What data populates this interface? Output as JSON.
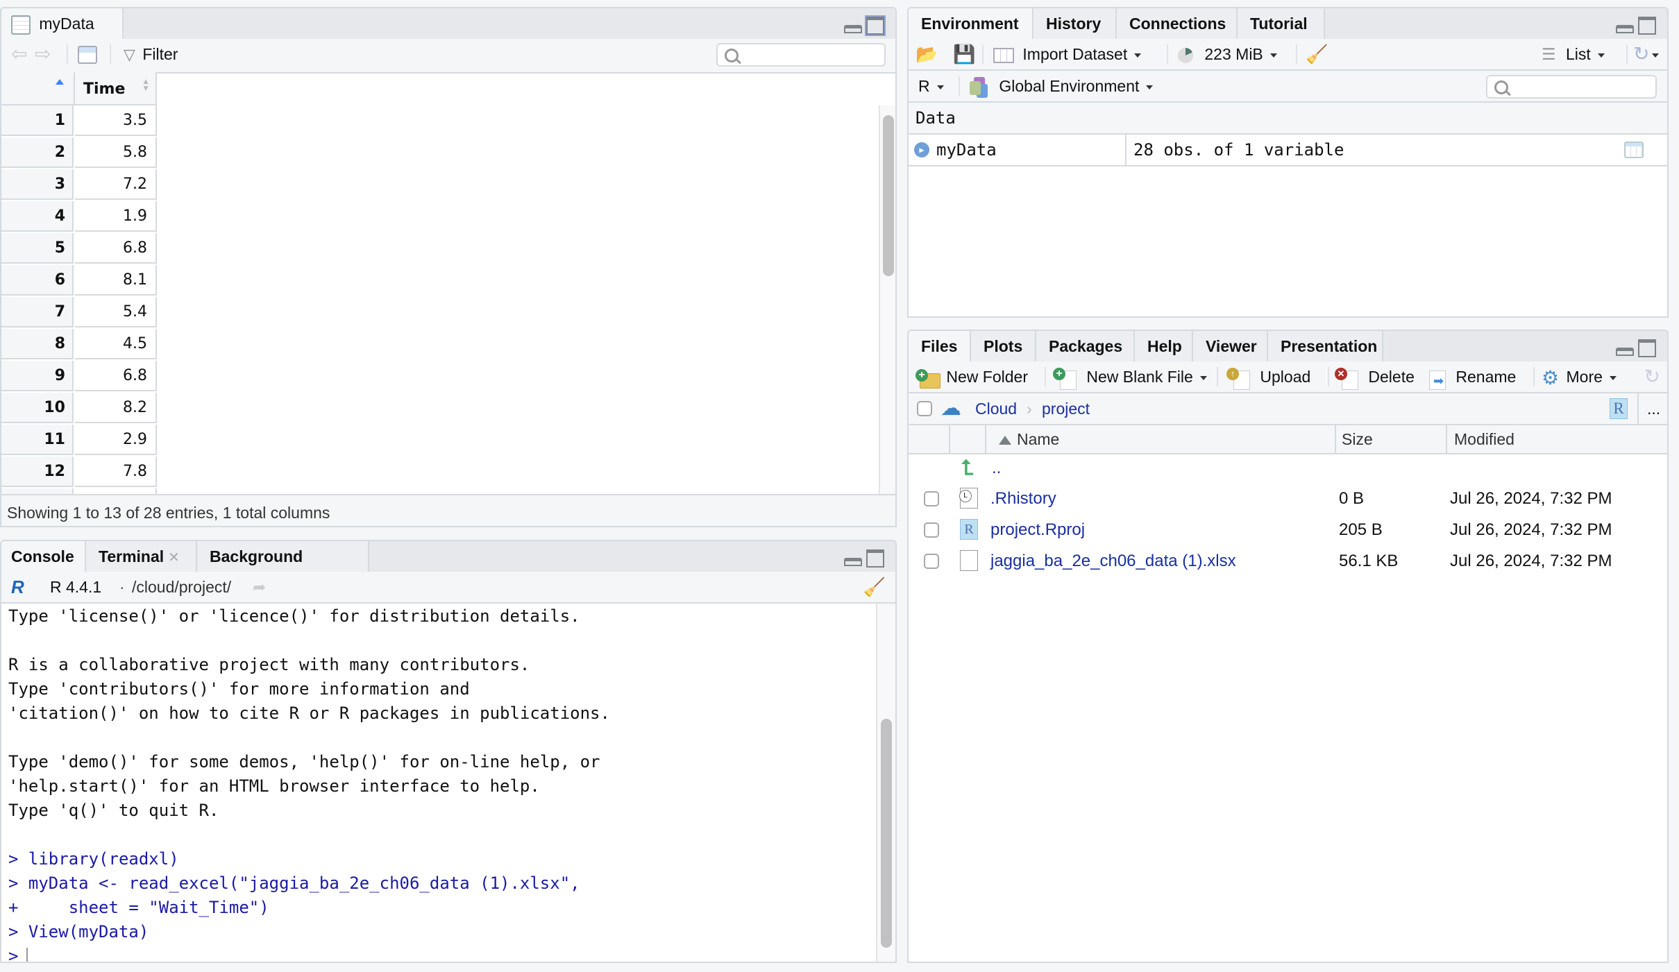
{
  "data_viewer": {
    "tab_label": "myData",
    "filter_label": "Filter",
    "search_placeholder": "",
    "column_header": "Time",
    "rows": [
      {
        "index": "1",
        "value": "3.5"
      },
      {
        "index": "2",
        "value": "5.8"
      },
      {
        "index": "3",
        "value": "7.2"
      },
      {
        "index": "4",
        "value": "1.9"
      },
      {
        "index": "5",
        "value": "6.8"
      },
      {
        "index": "6",
        "value": "8.1"
      },
      {
        "index": "7",
        "value": "5.4"
      },
      {
        "index": "8",
        "value": "4.5"
      },
      {
        "index": "9",
        "value": "6.8"
      },
      {
        "index": "10",
        "value": "8.2"
      },
      {
        "index": "11",
        "value": "2.9"
      },
      {
        "index": "12",
        "value": "7.8"
      }
    ],
    "status": "Showing 1 to 13 of 28 entries, 1 total columns"
  },
  "console": {
    "tabs": [
      {
        "label": "Console",
        "closable": false
      },
      {
        "label": "Terminal",
        "closable": true
      },
      {
        "label": "Background Jobs",
        "closable": true
      }
    ],
    "r_version": "R 4.4.1",
    "separator": "·",
    "working_dir": "/cloud/project/",
    "output_lines": [
      "Type 'license()' or 'licence()' for distribution details.",
      "",
      "R is a collaborative project with many contributors.",
      "Type 'contributors()' for more information and",
      "'citation()' on how to cite R or R packages in publications.",
      "",
      "Type 'demo()' for some demos, 'help()' for on-line help, or",
      "'help.start()' for an HTML browser interface to help.",
      "Type 'q()' to quit R.",
      ""
    ],
    "command_lines": [
      "> library(readxl)",
      "> myData <- read_excel(\"jaggia_ba_2e_ch06_data (1).xlsx\",",
      "+     sheet = \"Wait_Time\")",
      "> View(myData)"
    ],
    "prompt": ">"
  },
  "environment": {
    "tabs": [
      "Environment",
      "History",
      "Connections",
      "Tutorial"
    ],
    "active_tab": "Environment",
    "toolbar": {
      "import_dataset": "Import Dataset",
      "memory": "223 MiB",
      "view_mode": "List"
    },
    "language": "R",
    "scope": "Global Environment",
    "section_header": "Data",
    "variables": [
      {
        "name": "myData",
        "description": "28 obs. of 1 variable"
      }
    ]
  },
  "files": {
    "tabs": [
      "Files",
      "Plots",
      "Packages",
      "Help",
      "Viewer",
      "Presentation"
    ],
    "active_tab": "Files",
    "toolbar": {
      "new_folder": "New Folder",
      "new_blank_file": "New Blank File",
      "upload": "Upload",
      "delete": "Delete",
      "rename": "Rename",
      "more": "More"
    },
    "breadcrumb": [
      "Cloud",
      "project"
    ],
    "more_menu": "...",
    "columns": {
      "name": "Name",
      "size": "Size",
      "modified": "Modified"
    },
    "parent_dir": "..",
    "items": [
      {
        "name": ".Rhistory",
        "size": "0 B",
        "modified": "Jul 26, 2024, 7:32 PM",
        "icon": "history-file-icon"
      },
      {
        "name": "project.Rproj",
        "size": "205 B",
        "modified": "Jul 26, 2024, 7:32 PM",
        "icon": "rproj-file-icon"
      },
      {
        "name": "jaggia_ba_2e_ch06_data (1).xlsx",
        "size": "56.1 KB",
        "modified": "Jul 26, 2024, 7:32 PM",
        "icon": "blank-file-icon"
      }
    ]
  }
}
